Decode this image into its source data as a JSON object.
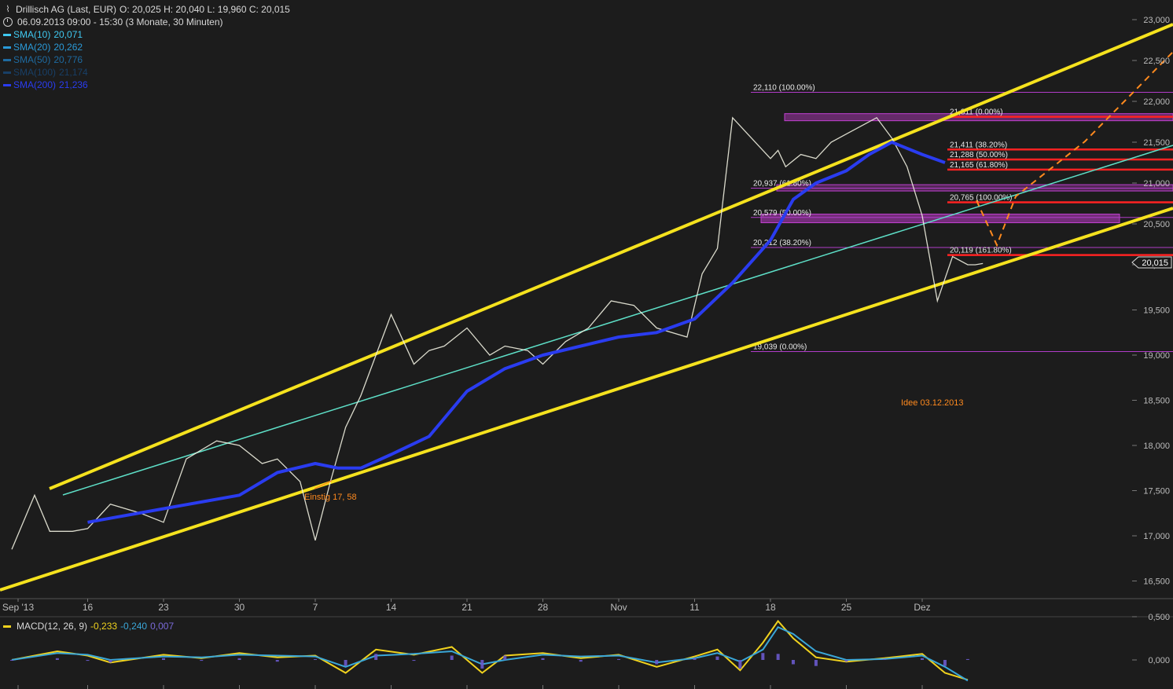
{
  "header": {
    "title": "Drillisch AG (Last, EUR)",
    "ohlc": "O: 20,025  H: 20,040  L: 19,960  C: 20,015",
    "period": "06.09.2013 09:00 - 15:30 (3 Monate, 30 Minuten)"
  },
  "sma_legend": [
    {
      "name": "SMA(10)",
      "value": "20,071",
      "color": "#3fc8f0"
    },
    {
      "name": "SMA(20)",
      "value": "20,262",
      "color": "#2a9ad8"
    },
    {
      "name": "SMA(50)",
      "value": "20,776",
      "color": "#1e6aa0"
    },
    {
      "name": "SMA(100)",
      "value": "21,174",
      "color": "#183f66"
    },
    {
      "name": "SMA(200)",
      "value": "21,236",
      "color": "#2a3cf0"
    }
  ],
  "macd_legend": {
    "label": "MACD(12, 26, 9)",
    "macd": "-0,233",
    "signal": "-0,240",
    "hist": "0,007",
    "macd_color": "#f0d21e",
    "signal_color": "#3aa7d8",
    "hist_color": "#6a5acd"
  },
  "annotations": {
    "einstieg": "Einstig 17, 58",
    "idee": "Idee 03.12.2013",
    "last_price": "20,015"
  },
  "fib_labels": [
    {
      "text": "22,110 (100.00%)",
      "value": 22.11
    },
    {
      "text": "20,937 (61.80%)",
      "value": 20.937
    },
    {
      "text": "20,579 (50.00%)",
      "value": 20.579
    },
    {
      "text": "20,212 (38.20%)",
      "value": 20.212
    },
    {
      "text": "19,039 (0.00%)",
      "value": 19.039
    },
    {
      "text": "21,811 (0.00%)",
      "value": 21.811
    },
    {
      "text": "21,411 (38.20%)",
      "value": 21.411
    },
    {
      "text": "21,288 (50.00%)",
      "value": 21.288
    },
    {
      "text": "21,165 (61.80%)",
      "value": 21.165
    },
    {
      "text": "20,765 (100.00%)",
      "value": 20.765
    },
    {
      "text": "20,119 (161.80%)",
      "value": 20.119
    }
  ],
  "chart_data": [
    {
      "type": "line",
      "title": "Drillisch AG (Last, EUR)",
      "x": [
        "Sep '13",
        "16",
        "23",
        "30",
        "7",
        "14",
        "21",
        "28",
        "Nov",
        "11",
        "18",
        "25",
        "Dez"
      ],
      "xlabel": "",
      "ylabel": "",
      "ylim": [
        16.3,
        23.1
      ],
      "y_ticks": [
        "16,500",
        "17,000",
        "17,500",
        "18,000",
        "18,500",
        "19,000",
        "19,500",
        "20,000",
        "20,500",
        "21,000",
        "21,500",
        "22,000",
        "22,500",
        "23,000"
      ],
      "y_tick_values": [
        16.5,
        17.0,
        17.5,
        18.0,
        18.5,
        19.0,
        19.5,
        20.0,
        20.5,
        21.0,
        21.5,
        22.0,
        22.5,
        23.0
      ],
      "grid": false,
      "series": [
        {
          "name": "Drillisch AG (Last, EUR)",
          "x_index": [
            0,
            0.3,
            0.5,
            0.8,
            1.0,
            1.3,
            1.7,
            2.0,
            2.3,
            2.7,
            3.0,
            3.3,
            3.5,
            3.8,
            4.0,
            4.2,
            4.4,
            4.6,
            4.8,
            5.0,
            5.3,
            5.5,
            5.7,
            6.0,
            6.3,
            6.5,
            6.8,
            7.0,
            7.3,
            7.6,
            7.9,
            8.2,
            8.5,
            8.9,
            9.1,
            9.3,
            9.5,
            9.7,
            10.0,
            10.1,
            10.2,
            10.4,
            10.6,
            10.8,
            11.0,
            11.2,
            11.4,
            11.6,
            11.8,
            12.0,
            12.2,
            12.4,
            12.6,
            12.7,
            12.8
          ],
          "values": [
            16.85,
            17.45,
            17.05,
            17.05,
            17.08,
            17.35,
            17.25,
            17.15,
            17.85,
            18.05,
            18.0,
            17.8,
            17.85,
            17.6,
            16.95,
            17.6,
            18.2,
            18.55,
            19.0,
            19.45,
            18.9,
            19.05,
            19.1,
            19.3,
            19.0,
            19.1,
            19.05,
            18.9,
            19.15,
            19.3,
            19.6,
            19.55,
            19.3,
            19.2,
            19.9,
            20.2,
            21.8,
            21.6,
            21.3,
            21.4,
            21.2,
            21.35,
            21.3,
            21.5,
            21.6,
            21.7,
            21.8,
            21.55,
            21.2,
            20.6,
            19.6,
            20.1,
            20.0,
            20.0,
            20.015
          ]
        },
        {
          "name": "SMA(200)",
          "x_index": [
            1.0,
            2.0,
            3.0,
            3.5,
            4.0,
            4.3,
            4.6,
            5.0,
            5.5,
            6.0,
            6.5,
            7.0,
            7.5,
            8.0,
            8.5,
            9.0,
            9.5,
            10.0,
            10.3,
            10.6,
            11.0,
            11.3,
            11.6,
            12.0,
            12.3
          ],
          "values": [
            17.15,
            17.3,
            17.45,
            17.7,
            17.8,
            17.75,
            17.75,
            17.9,
            18.1,
            18.6,
            18.85,
            19.0,
            19.1,
            19.2,
            19.25,
            19.4,
            19.8,
            20.3,
            20.8,
            21.0,
            21.15,
            21.35,
            21.5,
            21.35,
            21.25
          ]
        }
      ]
    },
    {
      "type": "line",
      "title": "MACD(12, 26, 9)",
      "x": [
        "Sep '13",
        "16",
        "23",
        "30",
        "7",
        "14",
        "21",
        "28",
        "Nov",
        "11",
        "18",
        "25",
        "Dez"
      ],
      "ylim": [
        -0.3,
        0.5
      ],
      "y_ticks": [
        "0,000",
        "0,500"
      ],
      "y_tick_values": [
        0.0,
        0.5
      ],
      "series": [
        {
          "name": "MACD",
          "x_index": [
            0,
            0.6,
            1.0,
            1.3,
            2.0,
            2.5,
            3.0,
            3.5,
            4.0,
            4.4,
            4.8,
            5.3,
            5.8,
            6.2,
            6.5,
            7.0,
            7.5,
            8.0,
            8.5,
            9.0,
            9.3,
            9.6,
            9.9,
            10.1,
            10.3,
            10.6,
            11.0,
            11.5,
            12.0,
            12.3,
            12.6
          ],
          "values": [
            0.0,
            0.1,
            0.05,
            -0.03,
            0.06,
            0.02,
            0.08,
            0.03,
            0.05,
            -0.15,
            0.12,
            0.06,
            0.15,
            -0.15,
            0.05,
            0.08,
            0.02,
            0.06,
            -0.08,
            0.04,
            0.12,
            -0.12,
            0.2,
            0.45,
            0.25,
            0.03,
            -0.02,
            0.02,
            0.07,
            -0.15,
            -0.23
          ]
        },
        {
          "name": "Signal",
          "x_index": [
            0,
            0.6,
            1.0,
            1.3,
            2.0,
            2.5,
            3.0,
            3.5,
            4.0,
            4.4,
            4.8,
            5.3,
            5.8,
            6.2,
            6.5,
            7.0,
            7.5,
            8.0,
            8.5,
            9.0,
            9.3,
            9.6,
            9.9,
            10.1,
            10.3,
            10.6,
            11.0,
            11.5,
            12.0,
            12.3,
            12.6
          ],
          "values": [
            0.0,
            0.08,
            0.06,
            0.0,
            0.04,
            0.03,
            0.06,
            0.05,
            0.04,
            -0.08,
            0.05,
            0.07,
            0.1,
            -0.05,
            0.0,
            0.06,
            0.04,
            0.05,
            -0.03,
            0.02,
            0.08,
            -0.02,
            0.12,
            0.38,
            0.3,
            0.1,
            0.0,
            0.01,
            0.05,
            -0.08,
            -0.24
          ]
        }
      ]
    }
  ]
}
